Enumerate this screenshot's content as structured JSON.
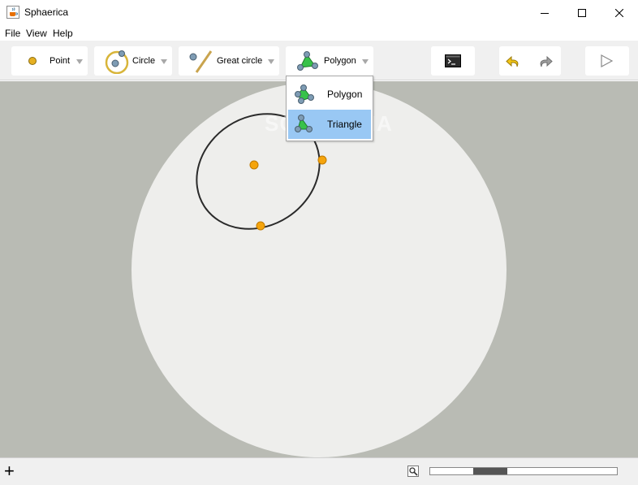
{
  "window": {
    "title": "Sphaerica",
    "app_icon": "java-cup-icon",
    "controls": [
      "minimize-icon",
      "maximize-icon",
      "close-icon"
    ]
  },
  "menubar": {
    "items": [
      "File",
      "View",
      "Help"
    ]
  },
  "toolbar": {
    "tools": [
      {
        "label": "Point",
        "icon": "point-icon",
        "has_dropdown": true
      },
      {
        "label": "Circle",
        "icon": "circle-icon",
        "has_dropdown": true
      },
      {
        "label": "Great circle",
        "icon": "great-circle-icon",
        "has_dropdown": true
      },
      {
        "label": "Polygon",
        "icon": "polygon-icon",
        "has_dropdown": true
      }
    ],
    "actions": [
      "console-icon",
      "undo-icon",
      "redo-icon",
      "play-icon"
    ]
  },
  "polygon_menu": {
    "items": [
      {
        "label": "Polygon",
        "icon": "polygon-icon",
        "selected": false
      },
      {
        "label": "Triangle",
        "icon": "triangle-icon",
        "selected": true
      }
    ]
  },
  "canvas": {
    "watermark": "SOFTPEDIA",
    "colors": {
      "background": "#b9bbb4",
      "sphere": "#eeeeec",
      "point": "#f5a40c",
      "curve": "#2a2a2a"
    },
    "objects": [
      "sphere",
      "small-circle",
      "center-point",
      "circle-point-right",
      "circle-point-bottom"
    ]
  },
  "statusbar": {
    "add_label": "+",
    "zoom_slider_fraction": 0.28
  }
}
